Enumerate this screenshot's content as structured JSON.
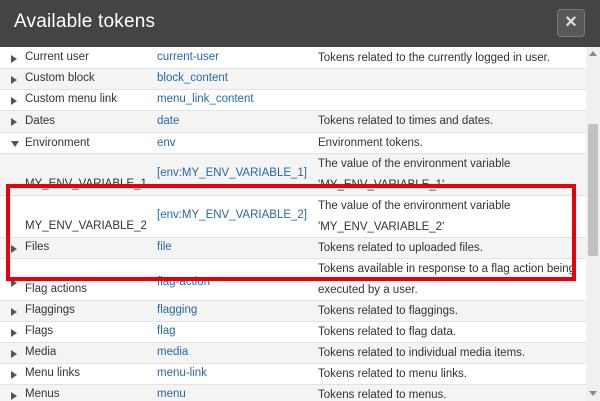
{
  "dialog": {
    "title": "Available tokens",
    "close_label": "×"
  },
  "tokens": [
    {
      "name": "Current user",
      "token": "current-user",
      "description": "Tokens related to the currently logged in user.",
      "expanded": false
    },
    {
      "name": "Custom block",
      "token": "block_content",
      "description": "",
      "expanded": false
    },
    {
      "name": "Custom menu link",
      "token": "menu_link_content",
      "description": "",
      "expanded": false
    },
    {
      "name": "Dates",
      "token": "date",
      "description": "Tokens related to times and dates.",
      "expanded": false
    },
    {
      "name": "Environment",
      "token": "env",
      "description": "Environment tokens.",
      "expanded": true
    },
    {
      "name": "MY_ENV_VARIABLE_1",
      "token": "[env:MY_ENV_VARIABLE_1]",
      "description": "The value of the environment variable 'MY_ENV_VARIABLE_1'",
      "child": true
    },
    {
      "name": "MY_ENV_VARIABLE_2",
      "token": "[env:MY_ENV_VARIABLE_2]",
      "description": "The value of the environment variable 'MY_ENV_VARIABLE_2'",
      "child": true
    },
    {
      "name": "Files",
      "token": "file",
      "description": "Tokens related to uploaded files.",
      "expanded": false
    },
    {
      "name": "Flag actions",
      "token": "flag-action",
      "description": "Tokens available in response to a flag action being executed by a user.",
      "expanded": false
    },
    {
      "name": "Flaggings",
      "token": "flagging",
      "description": "Tokens related to flaggings.",
      "expanded": false
    },
    {
      "name": "Flags",
      "token": "flag",
      "description": "Tokens related to flag data.",
      "expanded": false
    },
    {
      "name": "Media",
      "token": "media",
      "description": "Tokens related to individual media items.",
      "expanded": false
    },
    {
      "name": "Menu links",
      "token": "menu-link",
      "description": "Tokens related to menu links.",
      "expanded": false
    },
    {
      "name": "Menus",
      "token": "menu",
      "description": "Tokens related to menus.",
      "expanded": false
    }
  ],
  "colors": {
    "titlebar": "#444444",
    "link": "#2469a8",
    "highlight_border": "#e8000b"
  }
}
